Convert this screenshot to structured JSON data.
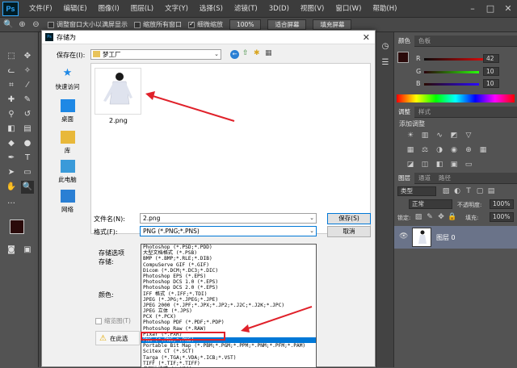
{
  "app": {
    "logo": "Ps"
  },
  "menu": [
    "文件(F)",
    "编辑(E)",
    "图像(I)",
    "图层(L)",
    "文字(Y)",
    "选择(S)",
    "滤镜(T)",
    "3D(D)",
    "视图(V)",
    "窗口(W)",
    "帮助(H)"
  ],
  "options_bar": {
    "resize_windows": "调整窗口大小以满屏显示",
    "zoom_all": "缩放所有窗口",
    "scrubby_zoom": "细微缩放",
    "zoom_pct": "100%",
    "fit_screen": "适合屏幕",
    "fill_screen": "填充屏幕"
  },
  "dialog": {
    "title": "存储为",
    "save_in_label": "保存在(I):",
    "save_in_value": "梦工厂",
    "places": [
      "快速访问",
      "桌面",
      "库",
      "此电脑",
      "网络"
    ],
    "file_name": "2.png",
    "filename_label": "文件名(N):",
    "filename_value": "2.png",
    "format_label": "格式(F):",
    "format_value": "PNG (*.PNG;*.PNS)",
    "save_btn": "保存(S)",
    "cancel_btn": "取消",
    "save_options": "存储选项",
    "store_label": "存储:",
    "color_label": "颜色:",
    "thumb_label": "缩览图(T)",
    "warning_text": "在此选",
    "formats": [
      "Photoshop (*.PSD;*.PDD)",
      "大型文档格式 (*.PSB)",
      "BMP (*.BMP;*.RLE;*.DIB)",
      "CompuServe GIF (*.GIF)",
      "Dicom (*.DCM;*.DC3;*.DIC)",
      "Photoshop EPS (*.EPS)",
      "Photoshop DCS 1.0 (*.EPS)",
      "Photoshop DCS 2.0 (*.EPS)",
      "IFF 格式 (*.IFF;*.TDI)",
      "JPEG (*.JPG;*.JPEG;*.JPE)",
      "JPEG 2000 (*.JPF;*.JPX;*.JP2;*.J2C;*.J2K;*.JPC)",
      "JPEG 立体 (*.JPS)",
      "PCX (*.PCX)",
      "Photoshop PDF (*.PDF;*.PDP)",
      "Photoshop Raw (*.RAW)",
      "Pixar (*.PXR)",
      "PNG (*.PNG;*.PNS)",
      "Portable Bit Map (*.PBM;*.PGM;*.PPM;*.PNM;*.PFM;*.PAM)",
      "Scitex CT (*.SCT)",
      "Targa (*.TGA;*.VDA;*.ICB;*.VST)",
      "TIFF (*.TIF;*.TIFF)",
      "多图片格式 (*.MPO)"
    ],
    "selected_format_index": 16
  },
  "panels": {
    "color_tabs": [
      "颜色",
      "色板"
    ],
    "r_label": "R",
    "r_value": "42",
    "g_label": "G",
    "g_value": "10",
    "b_label": "B",
    "b_value": "10",
    "adjust_tabs": [
      "调整",
      "样式"
    ],
    "adjust_title": "添加调整",
    "layer_tabs": [
      "图层",
      "通道",
      "路径"
    ],
    "kind": "类型",
    "blend": "正常",
    "opacity_label": "不透明度:",
    "opacity": "100%",
    "lock_label": "锁定:",
    "fill_label": "填充:",
    "fill": "100%",
    "layer_name": "图层 0"
  },
  "colors": {
    "foreground": "#2a0a0a",
    "background": "#f08a8a",
    "accent": "#0078d7",
    "annotation": "#e0212a"
  }
}
